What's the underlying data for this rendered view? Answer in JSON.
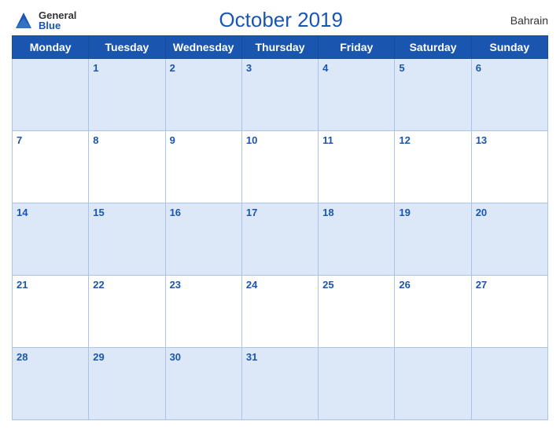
{
  "header": {
    "logo_general": "General",
    "logo_blue": "Blue",
    "title": "October 2019",
    "country": "Bahrain"
  },
  "weekdays": [
    "Monday",
    "Tuesday",
    "Wednesday",
    "Thursday",
    "Friday",
    "Saturday",
    "Sunday"
  ],
  "weeks": [
    [
      null,
      1,
      2,
      3,
      4,
      5,
      6
    ],
    [
      7,
      8,
      9,
      10,
      11,
      12,
      13
    ],
    [
      14,
      15,
      16,
      17,
      18,
      19,
      20
    ],
    [
      21,
      22,
      23,
      24,
      25,
      26,
      27
    ],
    [
      28,
      29,
      30,
      31,
      null,
      null,
      null
    ]
  ]
}
